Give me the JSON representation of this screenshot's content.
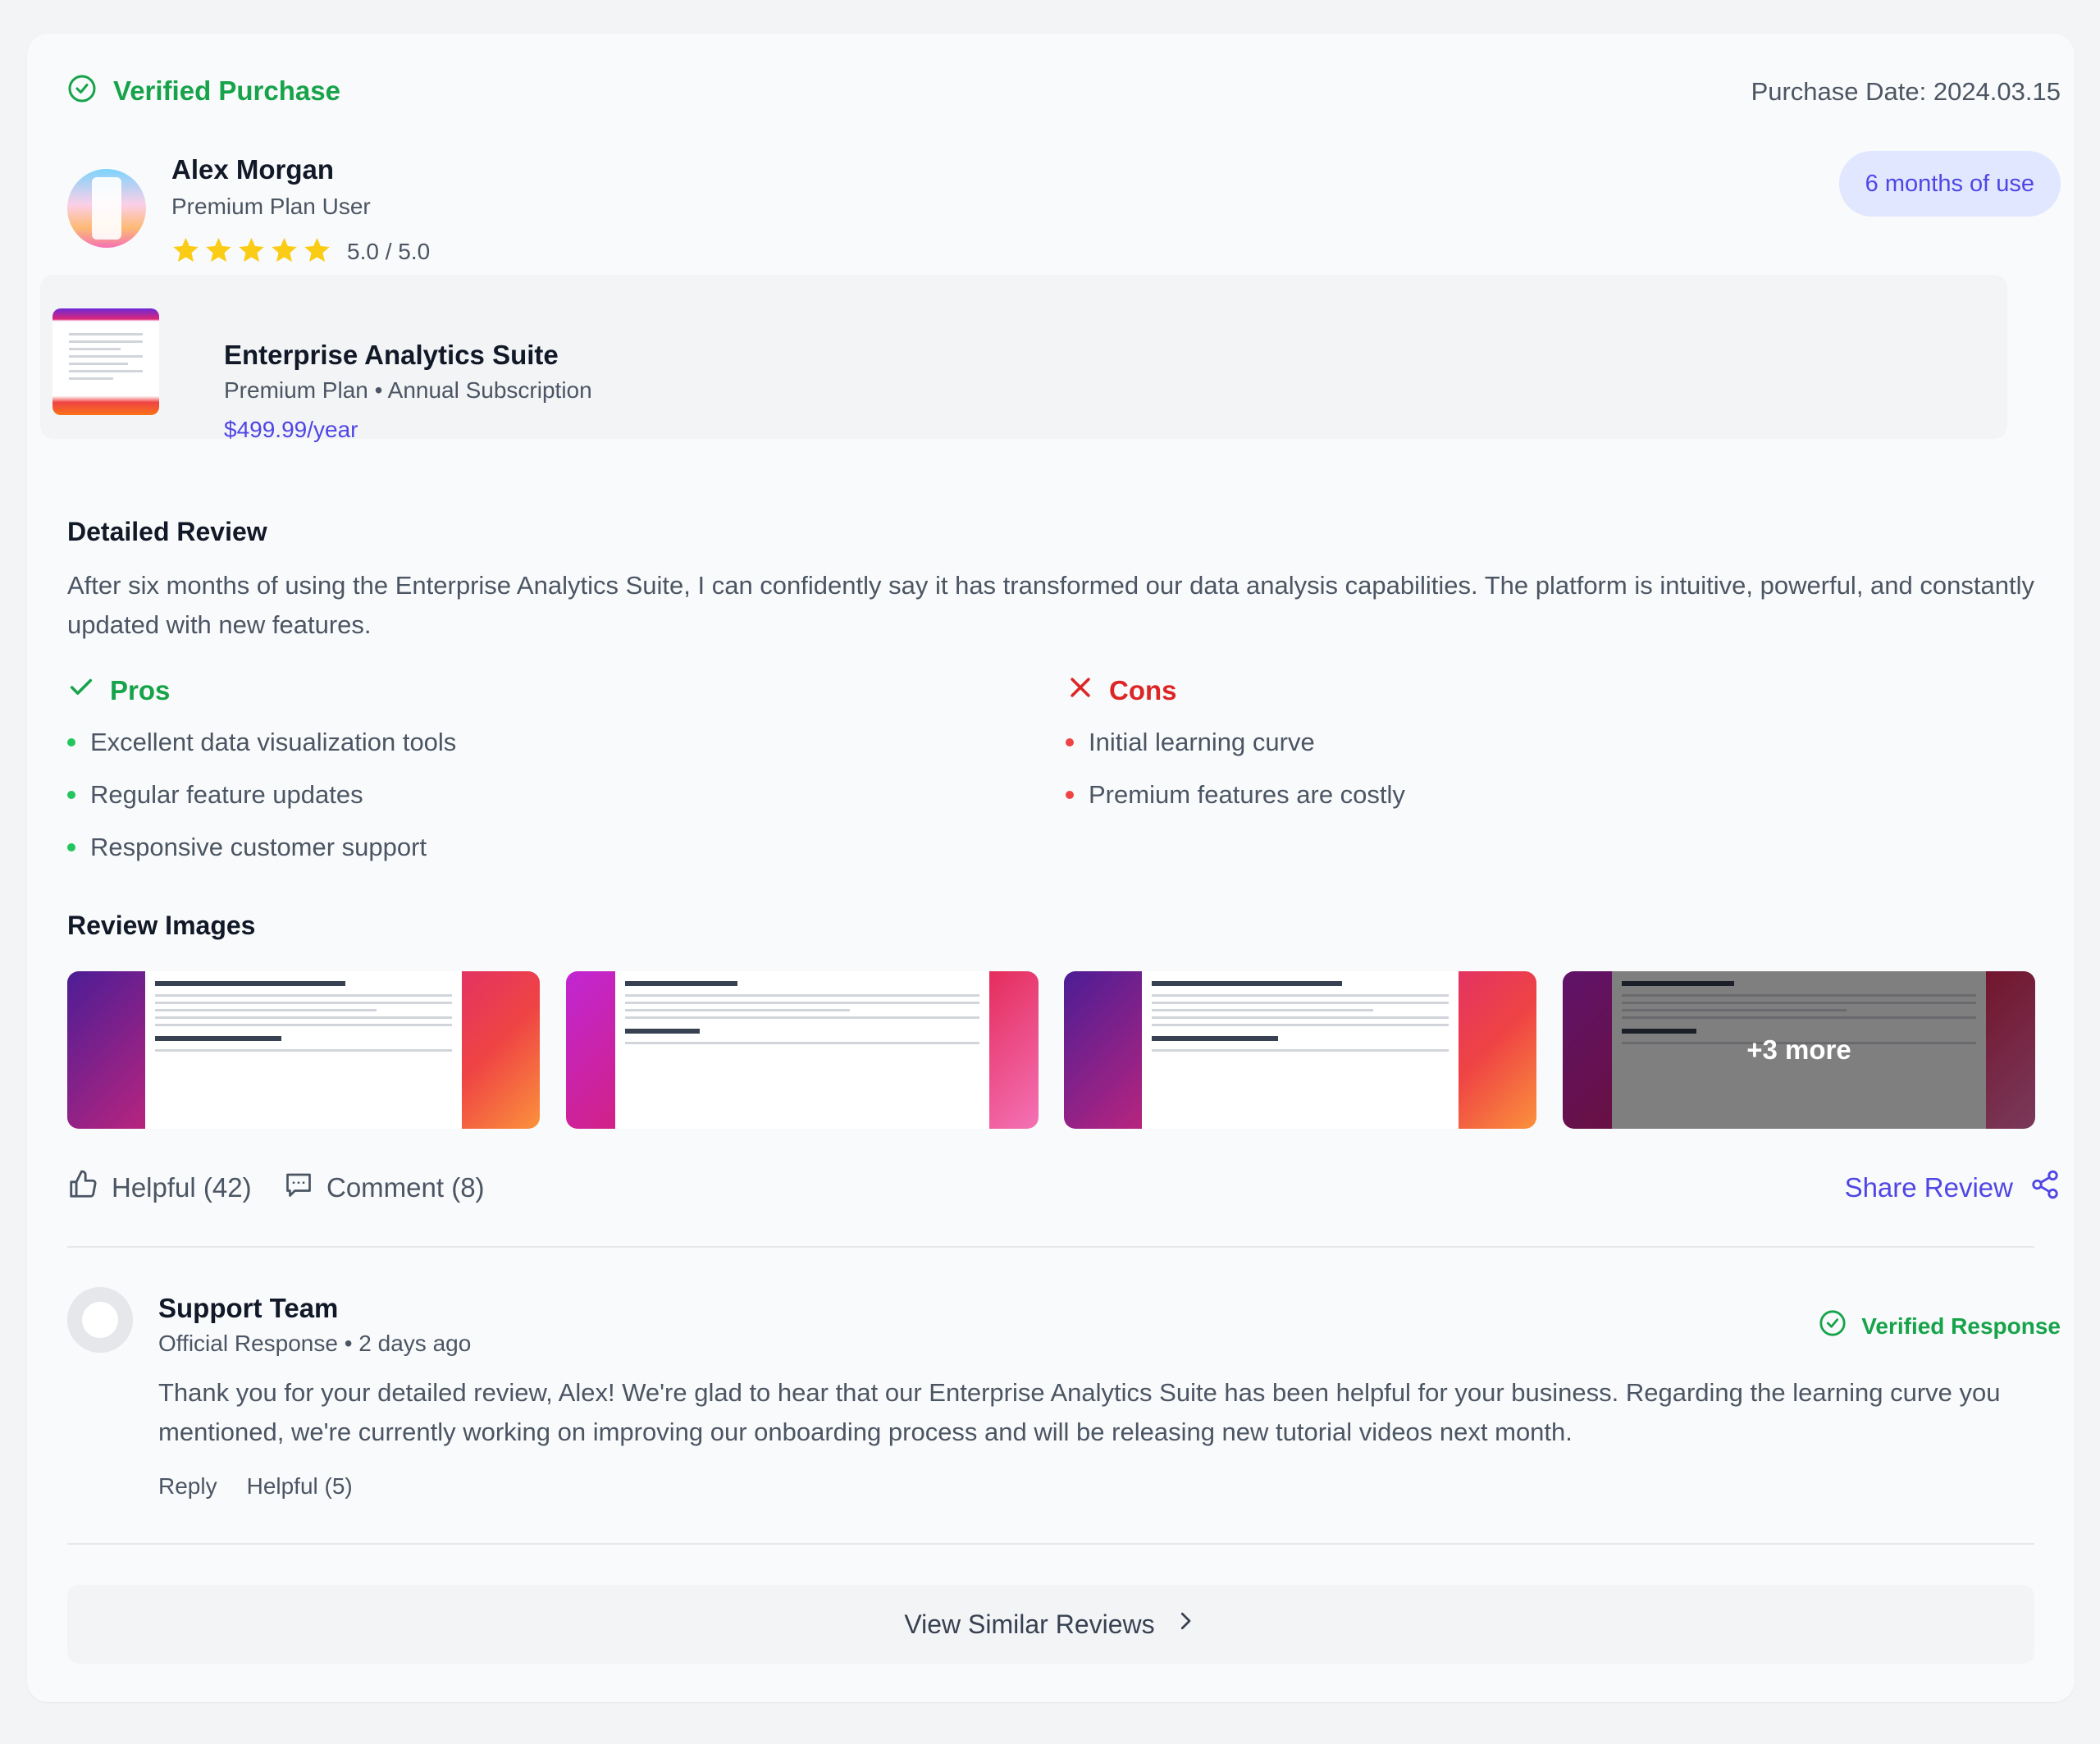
{
  "header": {
    "verified_label": "Verified Purchase",
    "purchase_date": "Purchase Date: 2024.03.15"
  },
  "reviewer": {
    "name": "Alex Morgan",
    "role": "Premium Plan User",
    "stars": 5,
    "rating_text": "5.0 / 5.0",
    "usage_badge": "6 months of use"
  },
  "product": {
    "name": "Enterprise Analytics Suite",
    "plan": "Premium Plan • Annual Subscription",
    "price": "$499.99/year"
  },
  "review": {
    "title": "Detailed Review",
    "body": "After six months of using the Enterprise Analytics Suite, I can confidently say it has transformed our data analysis capabilities. The platform is intuitive, powerful, and constantly updated with new features.",
    "pros_title": "Pros",
    "pros": [
      "Excellent data visualization tools",
      "Regular feature updates",
      "Responsive customer support"
    ],
    "cons_title": "Cons",
    "cons": [
      "Initial learning curve",
      "Premium features are costly"
    ]
  },
  "images": {
    "title": "Review Images",
    "more_label": "+3 more"
  },
  "actions": {
    "helpful": "Helpful (42)",
    "comment": "Comment (8)",
    "share": "Share Review"
  },
  "response": {
    "name": "Support Team",
    "meta": "Official Response • 2 days ago",
    "verified_label": "Verified Response",
    "body": "Thank you for your detailed review, Alex! We're glad to hear that our Enterprise Analytics Suite has been helpful for your business. Regarding the learning curve you mentioned, we're currently working on improving our onboarding process and will be releasing new tutorial videos next month.",
    "reply": "Reply",
    "helpful": "Helpful (5)"
  },
  "footer": {
    "similar": "View Similar Reviews"
  },
  "colors": {
    "success": "#16a34a",
    "danger": "#dc2626",
    "accent": "#4f46e5",
    "star": "#facc15"
  }
}
